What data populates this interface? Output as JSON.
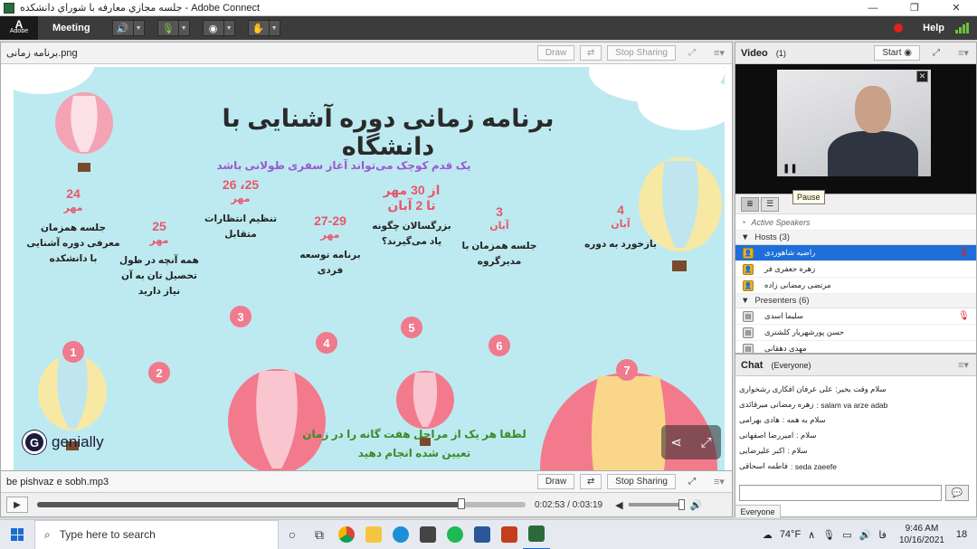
{
  "window": {
    "title": "جلسه مجازي معارفه با شوراي دانشكده - Adobe Connect",
    "minimize": "—",
    "maximize": "❐",
    "close": "✕"
  },
  "menubar": {
    "adobe_mark": "A",
    "adobe_text": "Adobe",
    "meeting": "Meeting",
    "help": "Help"
  },
  "share_pod": {
    "title": "برنامه زمانی.png",
    "draw": "Draw",
    "stop_sharing": "Stop Sharing"
  },
  "slide": {
    "title": "برنامه زمانی دوره آشنایی با دانشگاه",
    "subtitle": "یک قدم کوچک می‌تواند آغاز سفری طولانی باشد",
    "steps": [
      {
        "date": "24",
        "month": "مهر",
        "desc1": "جلسه همزمان",
        "desc2": "معرفی دوره آشنایی",
        "desc3": "با دانشکده",
        "num": "1"
      },
      {
        "date": "25",
        "month": "مهر",
        "desc1": "همه آنچه در طول",
        "desc2": "تحصیل تان به آن",
        "desc3": "نیاز دارید",
        "num": "2"
      },
      {
        "date": "25، 26",
        "month": "مهر",
        "desc1": "تنظیم انتظارات",
        "desc2": "متقابل",
        "desc3": "",
        "num": "3"
      },
      {
        "date": "27-29",
        "month": "مهر",
        "desc1": "برنامه توسعه",
        "desc2": "فردی",
        "desc3": "",
        "num": "4"
      },
      {
        "date": "از 30 مهر",
        "month": "تا 2 آبان",
        "desc1": "بزرگسالان چگونه",
        "desc2": "یاد می‌گیرند؟",
        "desc3": "",
        "num": "5"
      },
      {
        "date": "3",
        "month": "آبان",
        "desc1": "جلسه همزمان با",
        "desc2": "مدیرگروه",
        "desc3": "",
        "num": "6"
      },
      {
        "date": "4",
        "month": "آبان",
        "desc1": "بازخورد به دوره",
        "desc2": "",
        "desc3": "",
        "num": "7"
      }
    ],
    "footer1": "لطفا هر یک از مراحل هفت گانه را در زمان",
    "footer2": "تعیین شده انجام دهید",
    "brand_mark": "G",
    "brand": "genially"
  },
  "audio_pod": {
    "title": "be pishvaz e sobh.mp3",
    "draw": "Draw",
    "stop_sharing": "Stop Sharing",
    "time": "0:02:53 / 0:03:19",
    "progress_fraction": 0.869
  },
  "video_pod": {
    "title": "Video",
    "count": "(1)",
    "start": "Start",
    "tooltip": "Pause"
  },
  "attendees": {
    "active_speakers": "Active Speakers",
    "hosts_label": "Hosts (3)",
    "hosts": [
      "راضیه شاهوردی",
      "زهره جعفری فر",
      "مرتضی رمضانی زاده"
    ],
    "presenters_label": "Presenters (6)",
    "presenters": [
      "سلیما اسدی",
      "حسن پورشهریار کلشتری",
      "مهدی دهقانی"
    ]
  },
  "chat": {
    "title": "Chat",
    "scope": "(Everyone)",
    "messages": [
      {
        "from": "علی عرفان افکاری رشخواری",
        "text": ":سلام وقت بخیر"
      },
      {
        "from": "زهره رمضانی میرقائدی",
        "text": ": salam va arze adab"
      },
      {
        "from": "هادی بهرامی",
        "text": ": سلام به همه"
      },
      {
        "from": "امیررضا اصفهانی",
        "text": ": سلام"
      },
      {
        "from": "اکبر علیرضایی",
        "text": ": سلام"
      },
      {
        "from": "فاطمه اسحاقی",
        "text": ": seda zaeefe"
      }
    ],
    "tab": "Everyone"
  },
  "taskbar": {
    "search_placeholder": "Type here to search",
    "weather": "74°F",
    "lang": "فا",
    "time": "9:46 AM",
    "date": "10/16/2021",
    "notifications": "18"
  },
  "colors": {
    "slide_bg": "#bdeaf0",
    "accent_pink": "#e8576b",
    "subtitle_purple": "#9b59d0",
    "footer_green": "#3d8a2a",
    "selection_blue": "#1e6fd9"
  }
}
